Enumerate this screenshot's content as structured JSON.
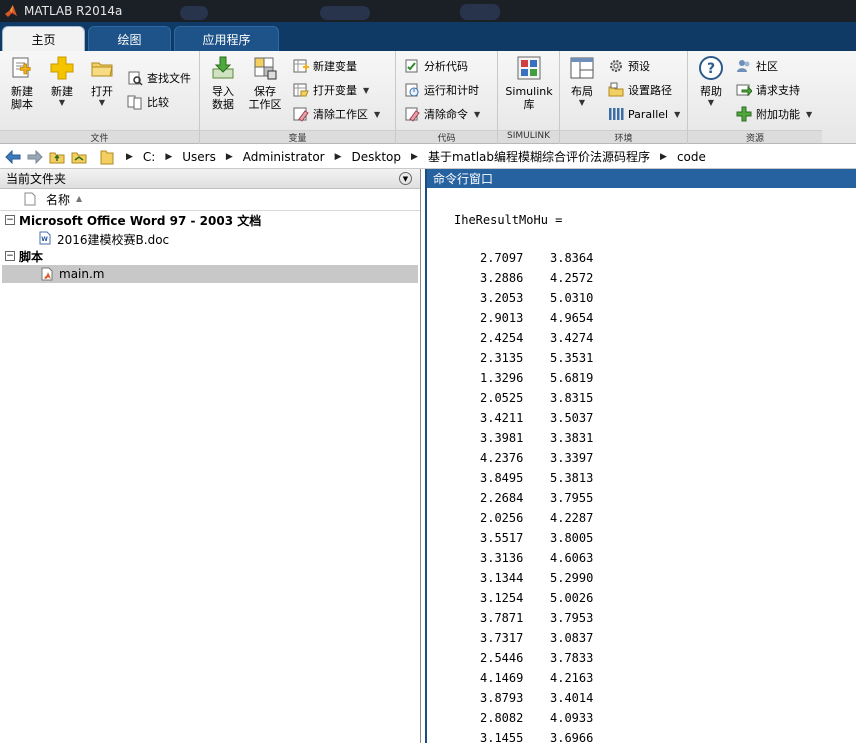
{
  "window": {
    "title": "MATLAB R2014a"
  },
  "tabs": [
    {
      "label": "主页",
      "active": true
    },
    {
      "label": "绘图",
      "active": false
    },
    {
      "label": "应用程序",
      "active": false
    }
  ],
  "ribbon": {
    "file_group": {
      "label": "文件",
      "new_script": "新建\n脚本",
      "new": "新建",
      "open": "打开",
      "find_files": "查找文件",
      "compare": "比较"
    },
    "variable_group": {
      "label": "变量",
      "import_data": "导入\n数据",
      "save_workspace": "保存\n工作区",
      "new_variable": "新建变量",
      "open_variable": "打开变量",
      "clear_workspace": "清除工作区"
    },
    "code_group": {
      "label": "代码",
      "analyze_code": "分析代码",
      "run_and_time": "运行和计时",
      "clear_commands": "清除命令"
    },
    "simulink_group": {
      "label": "SIMULINK",
      "simulink_library": "Simulink\n库"
    },
    "environment_group": {
      "label": "环境",
      "layout": "布局",
      "preferences": "预设",
      "set_path": "设置路径",
      "parallel": "Parallel"
    },
    "resources_group": {
      "label": "资源",
      "help": "帮助",
      "community": "社区",
      "request_support": "请求支持",
      "add_ons": "附加功能"
    }
  },
  "address_bar": {
    "path": [
      "C:",
      "Users",
      "Administrator",
      "Desktop",
      "基于matlab编程模糊综合评价法源码程序",
      "code"
    ]
  },
  "current_folder": {
    "title": "当前文件夹",
    "column_name": "名称",
    "groups": [
      {
        "label": "Microsoft Office Word 97 - 2003 文档",
        "files": [
          {
            "name": "2016建模校赛B.doc",
            "selected": false
          }
        ]
      },
      {
        "label": "脚本",
        "files": [
          {
            "name": "main.m",
            "selected": true
          }
        ]
      }
    ]
  },
  "command_window": {
    "title": "命令行窗口",
    "variable_line": "IheResultMoHu =",
    "rows": [
      [
        "2.7097",
        "3.8364"
      ],
      [
        "3.2886",
        "4.2572"
      ],
      [
        "3.2053",
        "5.0310"
      ],
      [
        "2.9013",
        "4.9654"
      ],
      [
        "2.4254",
        "3.4274"
      ],
      [
        "2.3135",
        "5.3531"
      ],
      [
        "1.3296",
        "5.6819"
      ],
      [
        "2.0525",
        "3.8315"
      ],
      [
        "3.4211",
        "3.5037"
      ],
      [
        "3.3981",
        "3.3831"
      ],
      [
        "4.2376",
        "3.3397"
      ],
      [
        "3.8495",
        "5.3813"
      ],
      [
        "2.2684",
        "3.7955"
      ],
      [
        "2.0256",
        "4.2287"
      ],
      [
        "3.5517",
        "3.8005"
      ],
      [
        "3.3136",
        "4.6063"
      ],
      [
        "3.1344",
        "5.2990"
      ],
      [
        "3.1254",
        "5.0026"
      ],
      [
        "3.7871",
        "3.7953"
      ],
      [
        "3.7317",
        "3.0837"
      ],
      [
        "2.5446",
        "3.7833"
      ],
      [
        "4.1469",
        "4.2163"
      ],
      [
        "3.8793",
        "3.4014"
      ],
      [
        "2.8082",
        "4.0933"
      ],
      [
        "3.1455",
        "3.6966"
      ]
    ]
  }
}
